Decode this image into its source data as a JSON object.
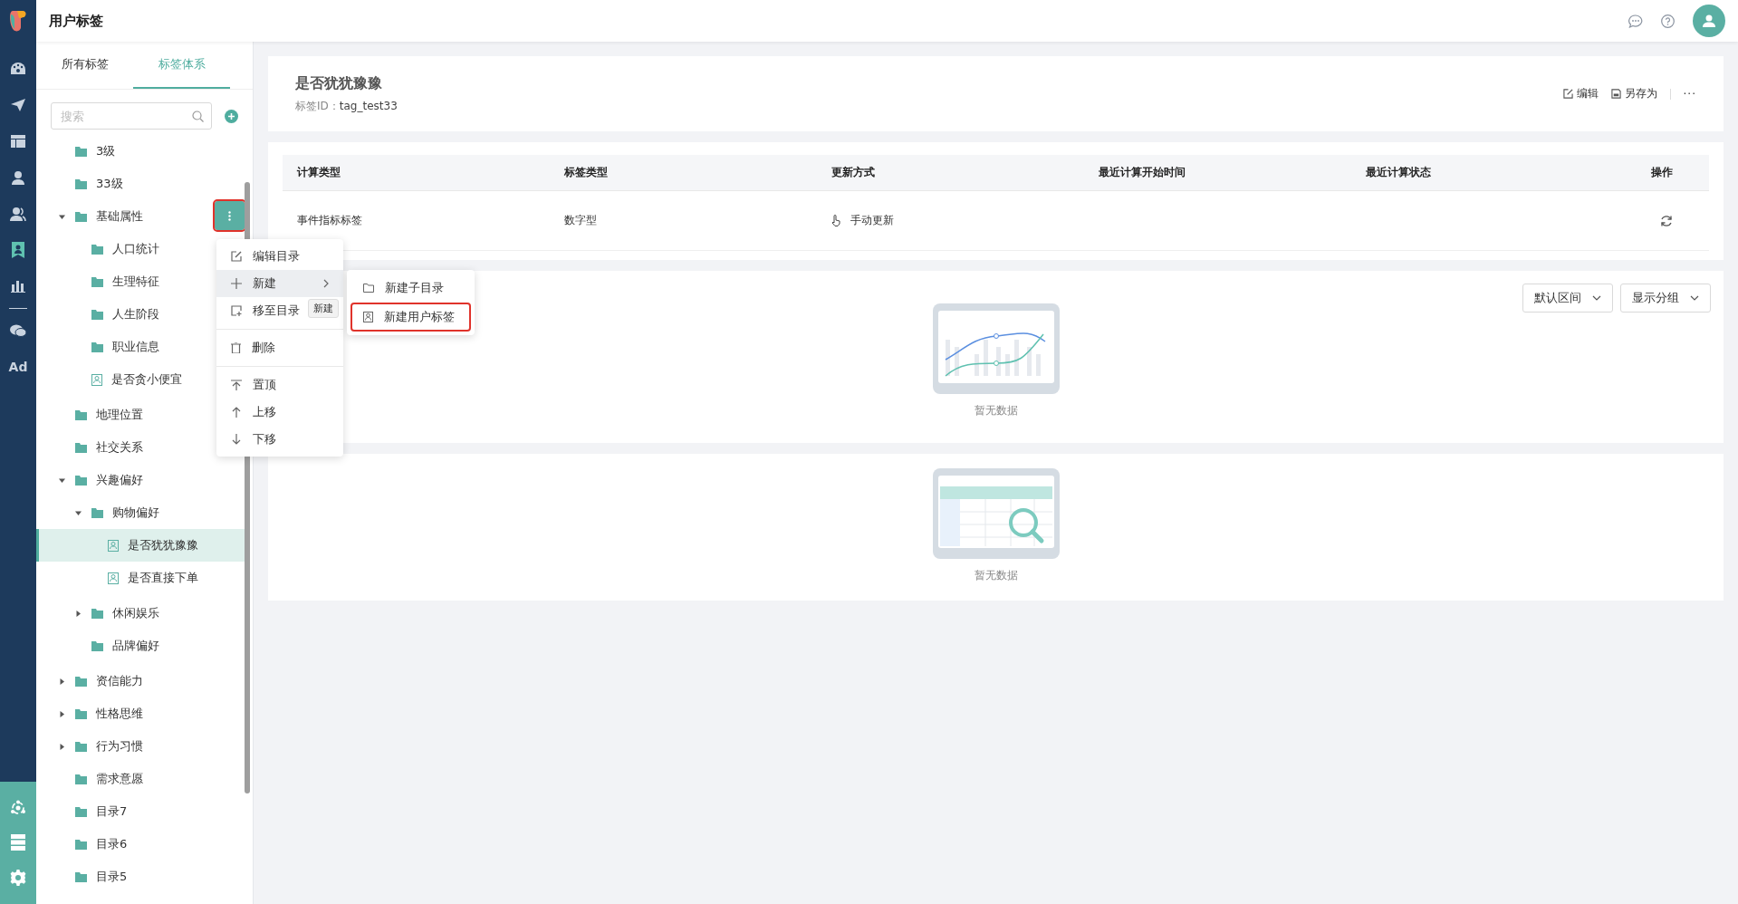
{
  "topbar": {
    "title": "用户标签"
  },
  "nav_rail": {
    "items": [
      {
        "kind": "icon",
        "selected": false
      },
      {
        "kind": "icon",
        "selected": false
      },
      {
        "kind": "icon",
        "selected": false
      },
      {
        "kind": "icon",
        "selected": false
      },
      {
        "kind": "icon",
        "selected": false
      },
      {
        "kind": "icon",
        "selected": true
      },
      {
        "kind": "icon",
        "selected": false
      },
      {
        "kind": "divider",
        "selected": false
      },
      {
        "kind": "icon",
        "selected": false
      },
      {
        "kind": "text",
        "label": "Ad",
        "selected": false
      }
    ]
  },
  "sidebar": {
    "tabs": [
      {
        "label": "所有标签",
        "selected": false
      },
      {
        "label": "标签体系",
        "selected": true
      }
    ],
    "search": {
      "placeholder": "搜索"
    },
    "tree": [
      {
        "label": "3级",
        "kind": "folder",
        "selected": false
      },
      {
        "label": "33级",
        "kind": "folder",
        "selected": false
      },
      {
        "label": "基础属性",
        "kind": "folder",
        "selected": false,
        "expanded": true,
        "menu_button": {
          "highlighted": true
        },
        "children": [
          {
            "label": "人口统计",
            "kind": "folder",
            "selected": false
          },
          {
            "label": "生理特征",
            "kind": "folder",
            "selected": false
          },
          {
            "label": "人生阶段",
            "kind": "folder",
            "selected": false
          },
          {
            "label": "职业信息",
            "kind": "folder",
            "selected": false
          },
          {
            "label": "是否贪小便宜",
            "kind": "tag",
            "selected": false
          }
        ]
      },
      {
        "label": "地理位置",
        "kind": "folder",
        "selected": false
      },
      {
        "label": "社交关系",
        "kind": "folder",
        "selected": false
      },
      {
        "label": "兴趣偏好",
        "kind": "folder",
        "selected": false,
        "expanded": true,
        "children": [
          {
            "label": "购物偏好",
            "kind": "folder",
            "selected": false,
            "expanded": true,
            "children": [
              {
                "label": "是否犹犹豫豫",
                "kind": "tag",
                "selected": true
              },
              {
                "label": "是否直接下单",
                "kind": "tag",
                "selected": false
              }
            ]
          },
          {
            "label": "休闲娱乐",
            "kind": "folder",
            "selected": false,
            "expanded": false
          },
          {
            "label": "品牌偏好",
            "kind": "folder",
            "selected": false
          }
        ]
      },
      {
        "label": "资信能力",
        "kind": "folder",
        "selected": false,
        "expanded": false
      },
      {
        "label": "性格思维",
        "kind": "folder",
        "selected": false,
        "expanded": false
      },
      {
        "label": "行为习惯",
        "kind": "folder",
        "selected": false,
        "expanded": false
      },
      {
        "label": "需求意愿",
        "kind": "folder",
        "selected": false
      },
      {
        "label": "目录7",
        "kind": "folder",
        "selected": false
      },
      {
        "label": "目录6",
        "kind": "folder",
        "selected": false
      },
      {
        "label": "目录5",
        "kind": "folder",
        "selected": false
      }
    ]
  },
  "context_menu": {
    "groups": [
      [
        {
          "label": "编辑目录",
          "kind": "edit",
          "selected": false
        },
        {
          "label": "新建",
          "kind": "add",
          "selected": true,
          "submenu": true
        },
        {
          "label": "移至目录",
          "kind": "move",
          "selected": false
        }
      ],
      [
        {
          "label": "删除",
          "kind": "delete",
          "selected": false
        }
      ],
      [
        {
          "label": "置顶",
          "kind": "top",
          "selected": false
        },
        {
          "label": "上移",
          "kind": "up",
          "selected": false
        },
        {
          "label": "下移",
          "kind": "down",
          "selected": false
        }
      ]
    ],
    "tooltip": "新建",
    "submenu": [
      {
        "label": "新建子目录",
        "kind": "folder",
        "highlighted": false
      },
      {
        "label": "新建用户标签",
        "kind": "tag",
        "highlighted": true
      }
    ]
  },
  "detail": {
    "title": "是否犹犹豫豫",
    "id_label": "标签ID：",
    "id_value": "tag_test33",
    "actions": [
      {
        "label": "编辑",
        "kind": "edit"
      },
      {
        "label": "另存为",
        "kind": "save"
      }
    ],
    "more": "···"
  },
  "info_table": {
    "columns": [
      "计算类型",
      "标签类型",
      "更新方式",
      "最近计算开始时间",
      "最近计算状态",
      "操作"
    ],
    "rows": [
      [
        "事件指标标签",
        "数字型",
        "手动更新",
        "",
        "",
        ""
      ]
    ]
  },
  "chart_card": {
    "dropdowns": [
      "默认区间",
      "显示分组"
    ],
    "empty_text": "暂无数据"
  },
  "table_card": {
    "empty_text": "暂无数据"
  }
}
